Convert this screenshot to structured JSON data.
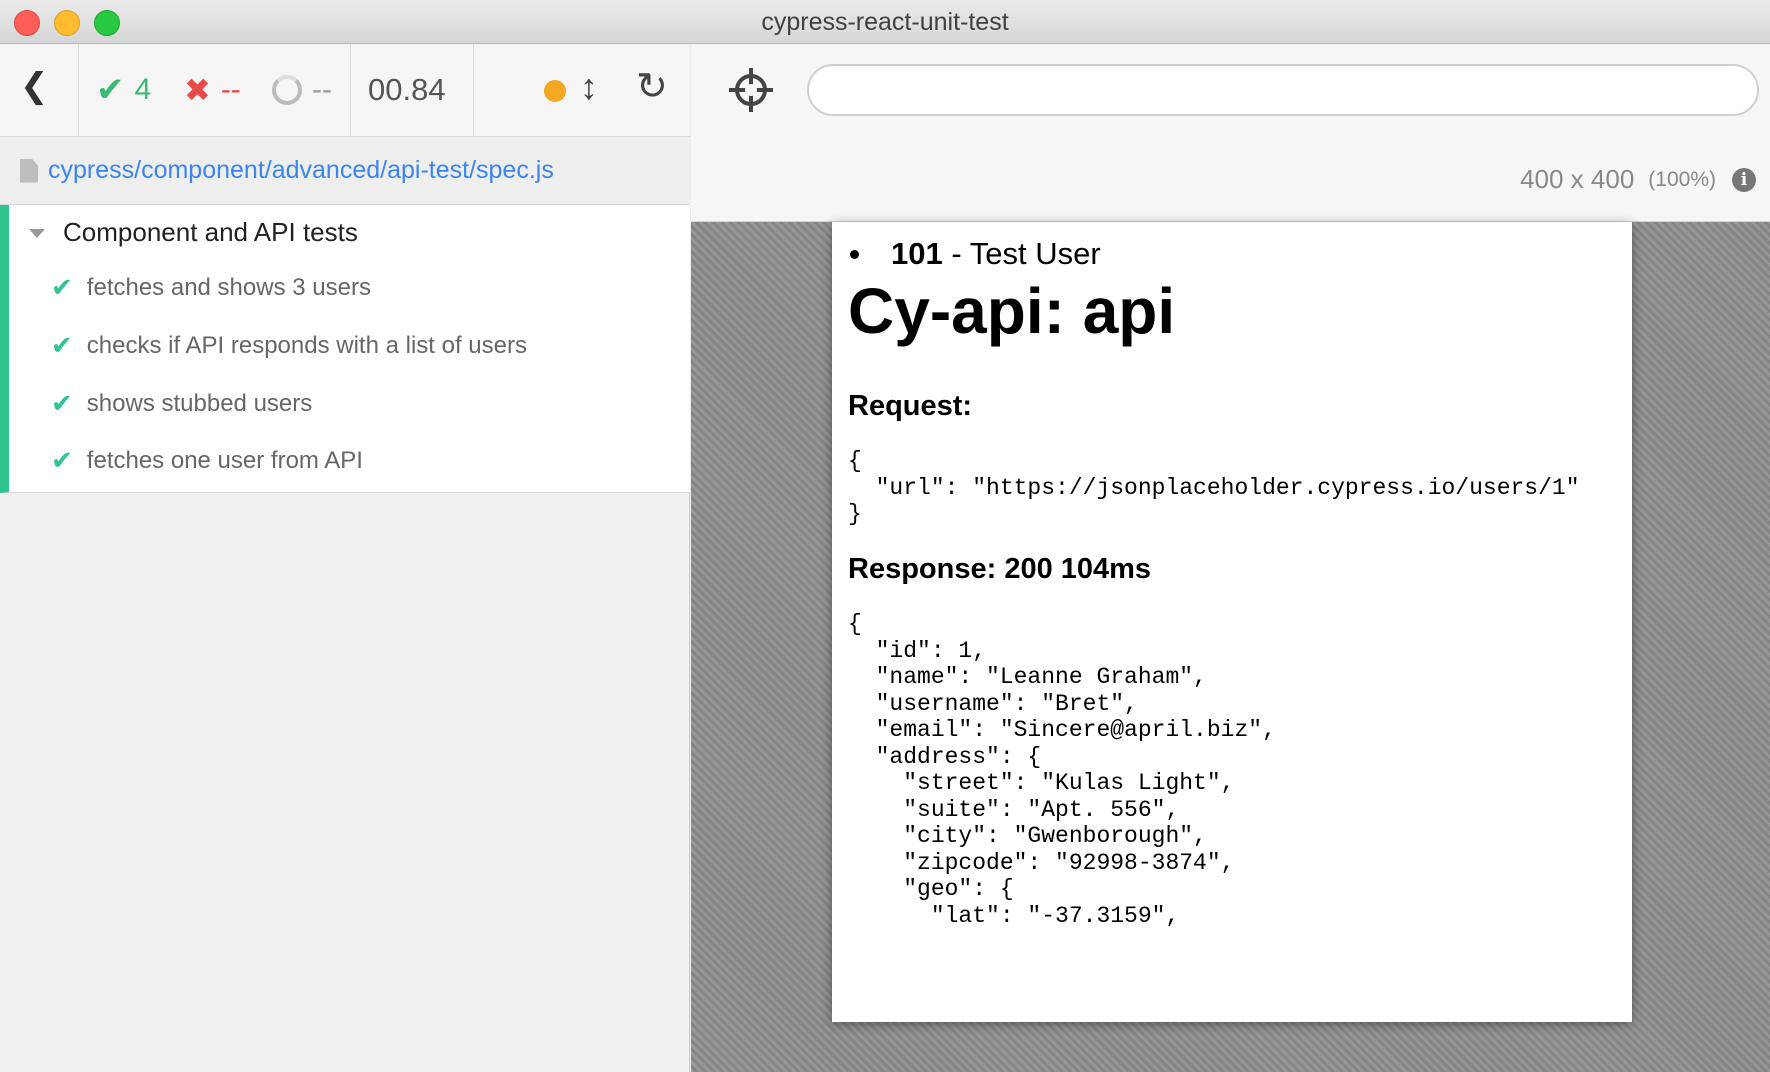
{
  "window": {
    "title": "cypress-react-unit-test"
  },
  "reporter": {
    "stats": {
      "passed": "4",
      "failed": "--",
      "pending": "--",
      "duration": "00.84"
    },
    "spec_path": "cypress/component/advanced/api-test/spec.js",
    "suite": {
      "title": "Component and API tests",
      "tests": [
        {
          "title": "fetches and shows 3 users",
          "state": "passed"
        },
        {
          "title": "checks if API responds with a list of users",
          "state": "passed"
        },
        {
          "title": "shows stubbed users",
          "state": "passed"
        },
        {
          "title": "fetches one user from API",
          "state": "passed"
        }
      ]
    }
  },
  "aut_header": {
    "url_value": "",
    "viewport_size": "400 x 400",
    "viewport_scale": "(100%)"
  },
  "aut": {
    "user_id": "101",
    "user_name": " - Test User",
    "heading": "Cy-api: api",
    "request_label": "Request:",
    "request_body": "{\n  \"url\": \"https://jsonplaceholder.cypress.io/users/1\"\n}",
    "response_label": "Response: 200 104ms",
    "response_body": "{\n  \"id\": 1,\n  \"name\": \"Leanne Graham\",\n  \"username\": \"Bret\",\n  \"email\": \"Sincere@april.biz\",\n  \"address\": {\n    \"street\": \"Kulas Light\",\n    \"suite\": \"Apt. 556\",\n    \"city\": \"Gwenborough\",\n    \"zipcode\": \"92998-3874\",\n    \"geo\": {\n      \"lat\": \"-37.3159\","
  },
  "colors": {
    "passed": "#2ec58f",
    "failed": "#e94b4b",
    "link": "#3a85f0",
    "running_dot": "#f5a623"
  }
}
